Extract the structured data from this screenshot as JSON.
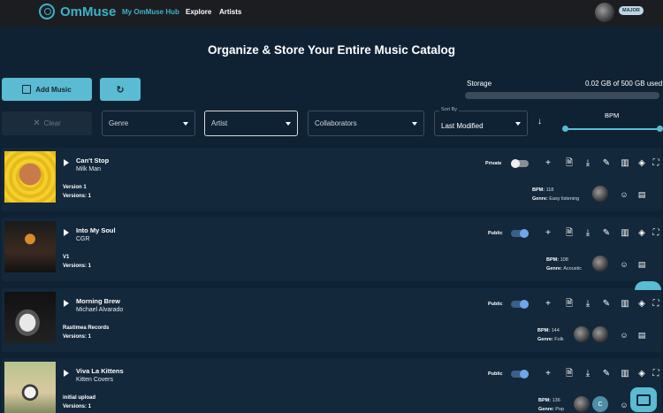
{
  "nav": {
    "brand": "OmMuse",
    "links": [
      "My OmMuse Hub",
      "Explore",
      "Artists"
    ],
    "badge": "MAJOR"
  },
  "headline": "Organize & Store Your Entire Music Catalog",
  "toolbar": {
    "add_music": "Add Music",
    "refresh_icon": "refresh-icon",
    "clear": "Clear",
    "genre": "Genre",
    "artist": "Artist",
    "collaborators": "Collaborators",
    "sort_by_label": "Sort By",
    "sort_by_value": "Last Modified",
    "bpm_label": "BPM"
  },
  "storage": {
    "label": "Storage",
    "value": "0.02 GB of 500 GB used",
    "used_fraction": 4e-05
  },
  "tracks": [
    {
      "title": "Can't Stop",
      "artist": "Milk Man",
      "version": "Version 1",
      "versions": "Versions: 1",
      "privacy": "Private",
      "public": false,
      "bpm": "118",
      "genre": "Easy listening"
    },
    {
      "title": "Into My Soul",
      "artist": "CGR",
      "version": "V1",
      "versions": "Versions: 1",
      "privacy": "Public",
      "public": true,
      "bpm": "108",
      "genre": "Acoustic"
    },
    {
      "title": "Morning Brew",
      "artist": "Michael Alvarado",
      "version": "Rastimea Records",
      "versions": "Versions: 1",
      "privacy": "Public",
      "public": true,
      "bpm": "144",
      "genre": "Folk"
    },
    {
      "title": "Viva La Kittens",
      "artist": "Kitten Covers",
      "version": "initial upload",
      "versions": "Versions: 1",
      "privacy": "Public",
      "public": true,
      "bpm": "136",
      "genre": "Pop"
    }
  ],
  "labels": {
    "bpm": "BPM:",
    "genre": "Genre:"
  },
  "colors": {
    "accent": "#5bbbd2",
    "background": "#0f2233",
    "card": "#13283b",
    "nav": "#1c1d21"
  }
}
